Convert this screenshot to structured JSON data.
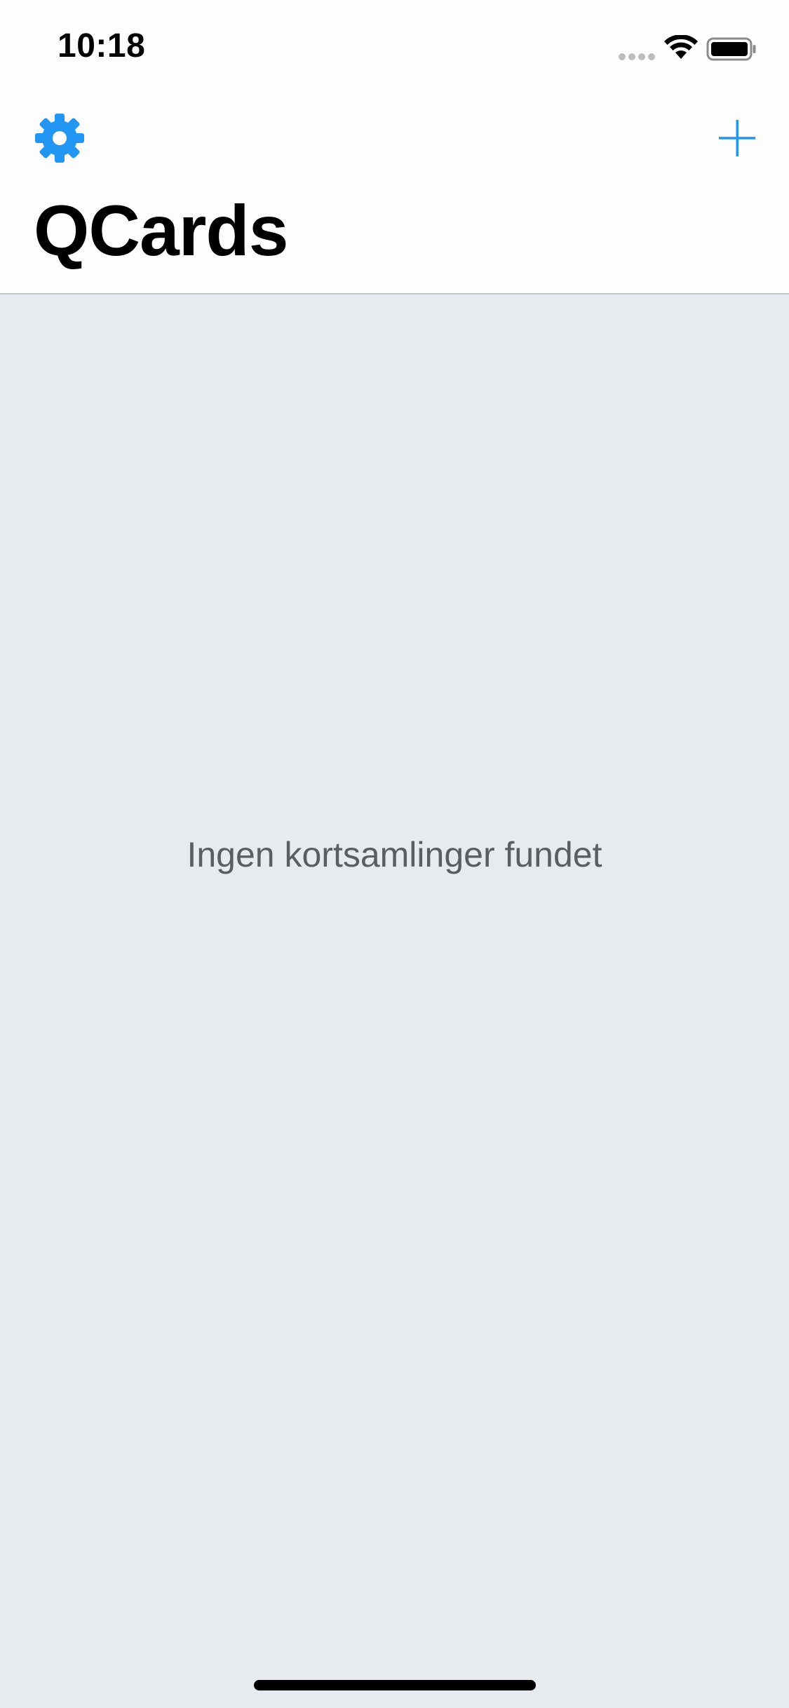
{
  "status_bar": {
    "time": "10:18"
  },
  "nav": {
    "title": "QCards",
    "settings_icon": "gear-icon",
    "add_icon": "plus-icon"
  },
  "empty_state": {
    "message": "Ingen kortsamlinger fundet"
  },
  "colors": {
    "accent": "#2196F3",
    "background": "#E6EBF0",
    "header_background": "#FDFDFD",
    "empty_text": "#5A5E63"
  }
}
